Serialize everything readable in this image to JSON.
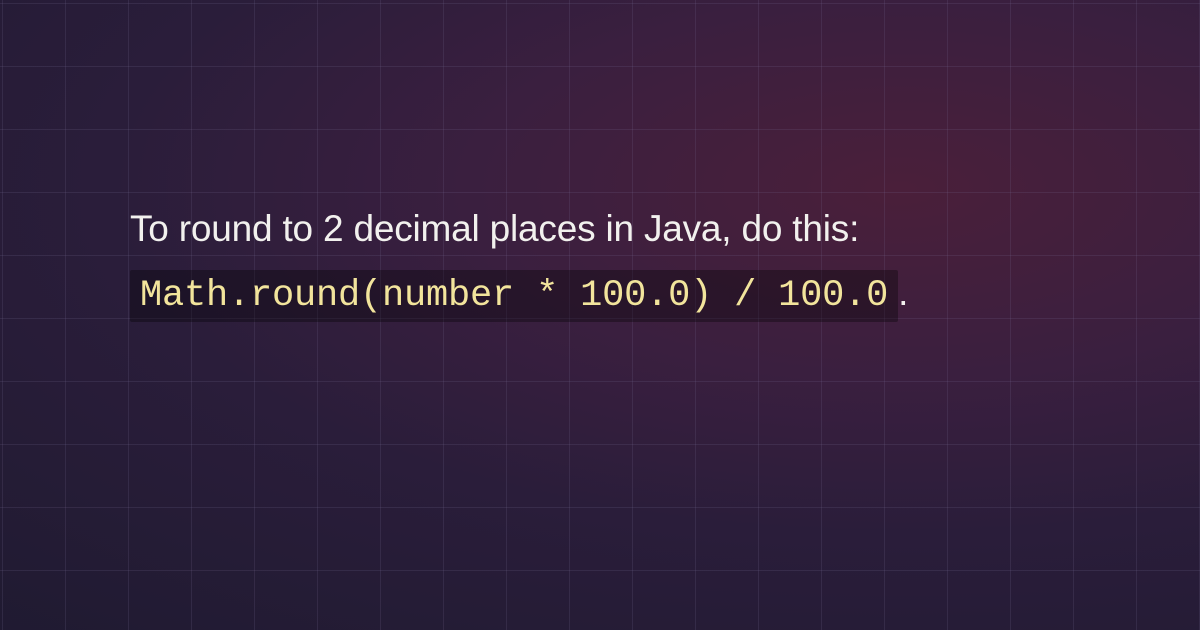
{
  "paragraph": {
    "text_before": "To round to 2 decimal places in Java, do this: ",
    "code": "Math.round(number * 100.0) / 100.0",
    "text_after": "."
  },
  "colors": {
    "text": "#f2f1ee",
    "code_text": "#f2e49c",
    "code_bg": "rgba(0,0,0,0.32)",
    "grid_line": "rgba(120,110,150,0.18)"
  }
}
